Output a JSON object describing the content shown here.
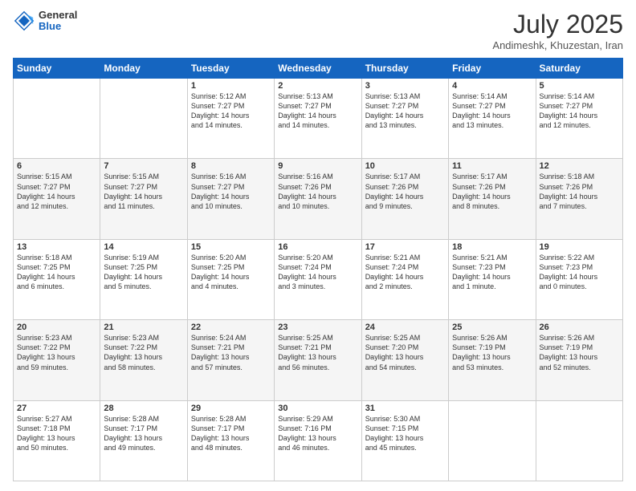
{
  "header": {
    "logo_general": "General",
    "logo_blue": "Blue",
    "month": "July 2025",
    "location": "Andimeshk, Khuzestan, Iran"
  },
  "days_of_week": [
    "Sunday",
    "Monday",
    "Tuesday",
    "Wednesday",
    "Thursday",
    "Friday",
    "Saturday"
  ],
  "weeks": [
    [
      {
        "day": "",
        "info": ""
      },
      {
        "day": "",
        "info": ""
      },
      {
        "day": "1",
        "info": "Sunrise: 5:12 AM\nSunset: 7:27 PM\nDaylight: 14 hours\nand 14 minutes."
      },
      {
        "day": "2",
        "info": "Sunrise: 5:13 AM\nSunset: 7:27 PM\nDaylight: 14 hours\nand 14 minutes."
      },
      {
        "day": "3",
        "info": "Sunrise: 5:13 AM\nSunset: 7:27 PM\nDaylight: 14 hours\nand 13 minutes."
      },
      {
        "day": "4",
        "info": "Sunrise: 5:14 AM\nSunset: 7:27 PM\nDaylight: 14 hours\nand 13 minutes."
      },
      {
        "day": "5",
        "info": "Sunrise: 5:14 AM\nSunset: 7:27 PM\nDaylight: 14 hours\nand 12 minutes."
      }
    ],
    [
      {
        "day": "6",
        "info": "Sunrise: 5:15 AM\nSunset: 7:27 PM\nDaylight: 14 hours\nand 12 minutes."
      },
      {
        "day": "7",
        "info": "Sunrise: 5:15 AM\nSunset: 7:27 PM\nDaylight: 14 hours\nand 11 minutes."
      },
      {
        "day": "8",
        "info": "Sunrise: 5:16 AM\nSunset: 7:27 PM\nDaylight: 14 hours\nand 10 minutes."
      },
      {
        "day": "9",
        "info": "Sunrise: 5:16 AM\nSunset: 7:26 PM\nDaylight: 14 hours\nand 10 minutes."
      },
      {
        "day": "10",
        "info": "Sunrise: 5:17 AM\nSunset: 7:26 PM\nDaylight: 14 hours\nand 9 minutes."
      },
      {
        "day": "11",
        "info": "Sunrise: 5:17 AM\nSunset: 7:26 PM\nDaylight: 14 hours\nand 8 minutes."
      },
      {
        "day": "12",
        "info": "Sunrise: 5:18 AM\nSunset: 7:26 PM\nDaylight: 14 hours\nand 7 minutes."
      }
    ],
    [
      {
        "day": "13",
        "info": "Sunrise: 5:18 AM\nSunset: 7:25 PM\nDaylight: 14 hours\nand 6 minutes."
      },
      {
        "day": "14",
        "info": "Sunrise: 5:19 AM\nSunset: 7:25 PM\nDaylight: 14 hours\nand 5 minutes."
      },
      {
        "day": "15",
        "info": "Sunrise: 5:20 AM\nSunset: 7:25 PM\nDaylight: 14 hours\nand 4 minutes."
      },
      {
        "day": "16",
        "info": "Sunrise: 5:20 AM\nSunset: 7:24 PM\nDaylight: 14 hours\nand 3 minutes."
      },
      {
        "day": "17",
        "info": "Sunrise: 5:21 AM\nSunset: 7:24 PM\nDaylight: 14 hours\nand 2 minutes."
      },
      {
        "day": "18",
        "info": "Sunrise: 5:21 AM\nSunset: 7:23 PM\nDaylight: 14 hours\nand 1 minute."
      },
      {
        "day": "19",
        "info": "Sunrise: 5:22 AM\nSunset: 7:23 PM\nDaylight: 14 hours\nand 0 minutes."
      }
    ],
    [
      {
        "day": "20",
        "info": "Sunrise: 5:23 AM\nSunset: 7:22 PM\nDaylight: 13 hours\nand 59 minutes."
      },
      {
        "day": "21",
        "info": "Sunrise: 5:23 AM\nSunset: 7:22 PM\nDaylight: 13 hours\nand 58 minutes."
      },
      {
        "day": "22",
        "info": "Sunrise: 5:24 AM\nSunset: 7:21 PM\nDaylight: 13 hours\nand 57 minutes."
      },
      {
        "day": "23",
        "info": "Sunrise: 5:25 AM\nSunset: 7:21 PM\nDaylight: 13 hours\nand 56 minutes."
      },
      {
        "day": "24",
        "info": "Sunrise: 5:25 AM\nSunset: 7:20 PM\nDaylight: 13 hours\nand 54 minutes."
      },
      {
        "day": "25",
        "info": "Sunrise: 5:26 AM\nSunset: 7:19 PM\nDaylight: 13 hours\nand 53 minutes."
      },
      {
        "day": "26",
        "info": "Sunrise: 5:26 AM\nSunset: 7:19 PM\nDaylight: 13 hours\nand 52 minutes."
      }
    ],
    [
      {
        "day": "27",
        "info": "Sunrise: 5:27 AM\nSunset: 7:18 PM\nDaylight: 13 hours\nand 50 minutes."
      },
      {
        "day": "28",
        "info": "Sunrise: 5:28 AM\nSunset: 7:17 PM\nDaylight: 13 hours\nand 49 minutes."
      },
      {
        "day": "29",
        "info": "Sunrise: 5:28 AM\nSunset: 7:17 PM\nDaylight: 13 hours\nand 48 minutes."
      },
      {
        "day": "30",
        "info": "Sunrise: 5:29 AM\nSunset: 7:16 PM\nDaylight: 13 hours\nand 46 minutes."
      },
      {
        "day": "31",
        "info": "Sunrise: 5:30 AM\nSunset: 7:15 PM\nDaylight: 13 hours\nand 45 minutes."
      },
      {
        "day": "",
        "info": ""
      },
      {
        "day": "",
        "info": ""
      }
    ]
  ]
}
